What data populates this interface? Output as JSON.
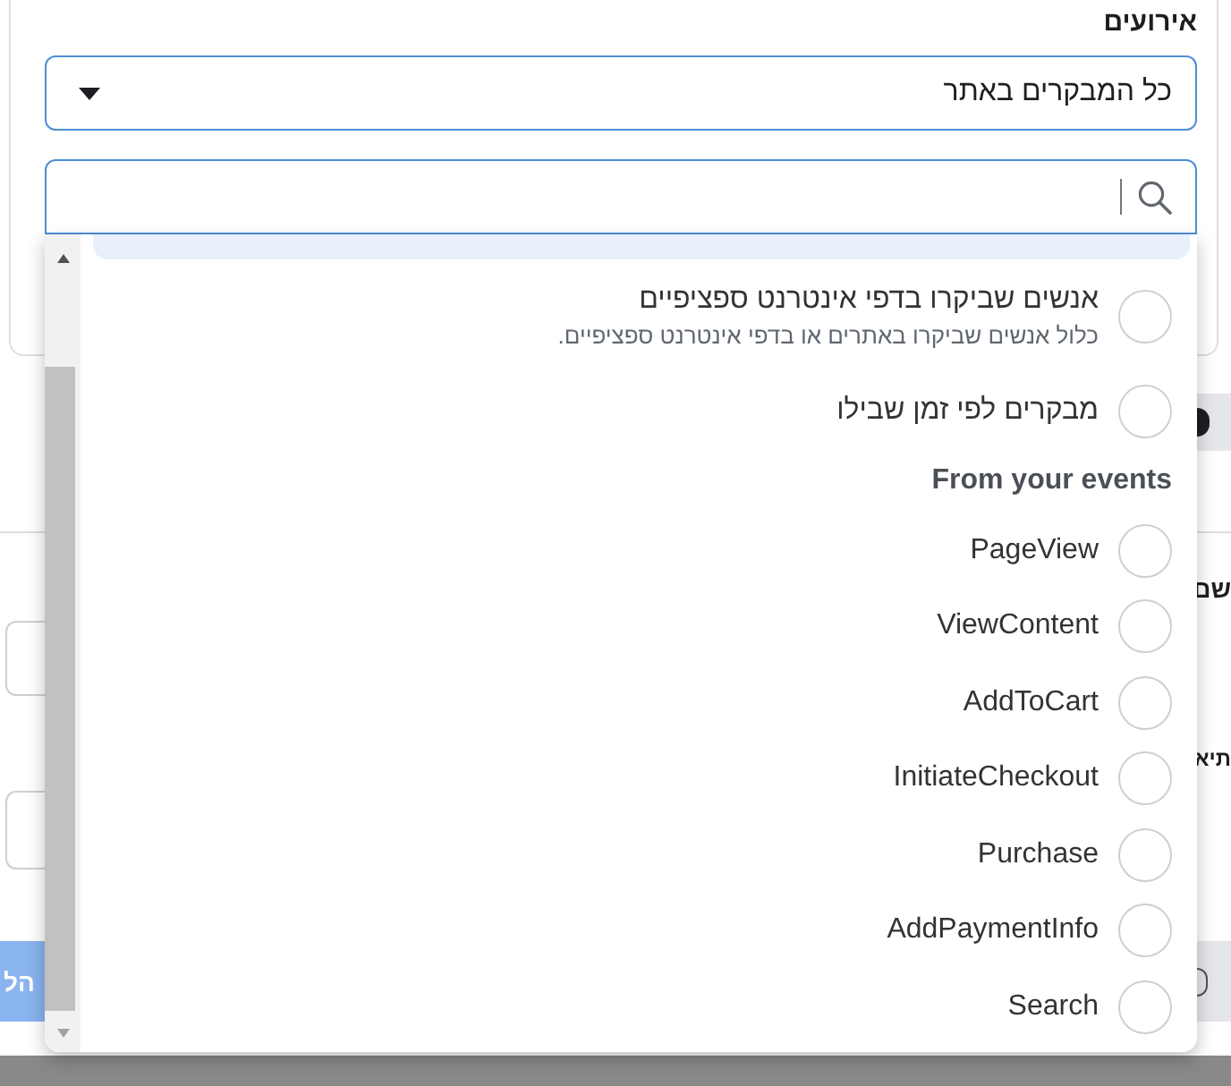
{
  "events_field": {
    "label": "אירועים",
    "value": "כל המבקרים באתר"
  },
  "search": {
    "focused": true
  },
  "options": [
    {
      "kind": "clipped",
      "selected": true
    },
    {
      "kind": "option",
      "title": "אנשים שביקרו בדפי אינטרנט ספציפיים",
      "description": "כלול אנשים שביקרו באתרים או בדפי אינטרנט ספציפיים.",
      "selected": false
    },
    {
      "kind": "option",
      "title": "מבקרים לפי זמן שבילו",
      "selected": false
    },
    {
      "kind": "heading",
      "title": "From your events"
    },
    {
      "kind": "option",
      "title": "PageView",
      "selected": false
    },
    {
      "kind": "option",
      "title": "ViewContent",
      "selected": false
    },
    {
      "kind": "option",
      "title": "AddToCart",
      "selected": false
    },
    {
      "kind": "option",
      "title": "InitiateCheckout",
      "selected": false
    },
    {
      "kind": "option",
      "title": "Purchase",
      "selected": false
    },
    {
      "kind": "option",
      "title": "AddPaymentInfo",
      "selected": false
    },
    {
      "kind": "option",
      "title": "Search",
      "selected": false
    }
  ],
  "behind_popup": {
    "label_1": "שם",
    "label_2": "תיא",
    "button": "הל"
  }
}
